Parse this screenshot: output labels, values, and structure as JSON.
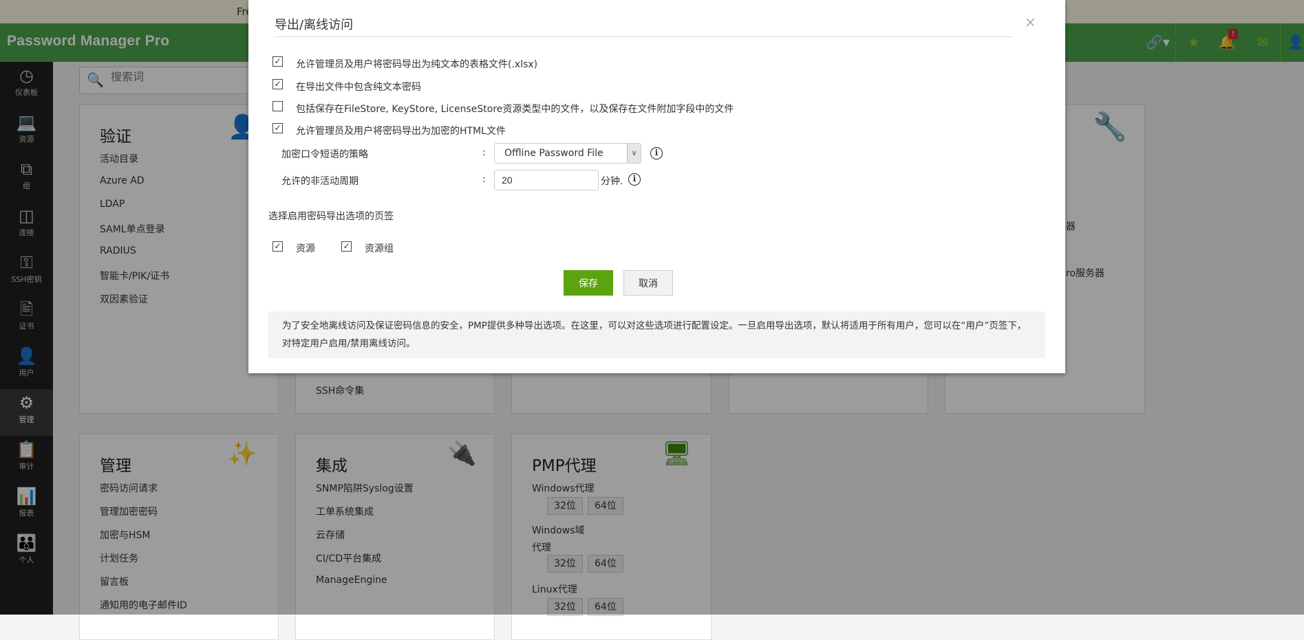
{
  "banner": {
    "text": "Fre"
  },
  "header": {
    "logo": "Password Manager Pro",
    "icons": [
      "link-icon",
      "favorite-user-icon",
      "bell-icon",
      "mail-icon",
      "user-icon"
    ]
  },
  "sidebar": {
    "items": [
      {
        "label": "仪表板",
        "icon": "dashboard-icon"
      },
      {
        "label": "资源",
        "icon": "monitor-icon"
      },
      {
        "label": "组",
        "icon": "groups-icon"
      },
      {
        "label": "连接",
        "icon": "connection-icon"
      },
      {
        "label": "SSH密钥",
        "icon": "ssh-key-icon"
      },
      {
        "label": "证书",
        "icon": "certificate-icon"
      },
      {
        "label": "用户",
        "icon": "user-icon"
      },
      {
        "label": "管理",
        "icon": "gear-icon",
        "active": true
      },
      {
        "label": "审计",
        "icon": "clipboard-icon"
      },
      {
        "label": "报表",
        "icon": "bar-chart-icon"
      },
      {
        "label": "个人",
        "icon": "personal-icon"
      }
    ]
  },
  "search": {
    "placeholder": "搜索词"
  },
  "cards": {
    "auth": {
      "title": "验证",
      "items": [
        "活动目录",
        "Azure AD",
        "LDAP",
        "SAML单点登录",
        "RADIUS",
        "智能卡/PIK/证书",
        "双因素验证"
      ]
    },
    "card2": {
      "items": [
        "SSH命令集"
      ]
    },
    "card5": {
      "items": [
        "器",
        "ro服务器"
      ]
    },
    "manage": {
      "title": "管理",
      "items": [
        "密码访问请求",
        "管理加密密码",
        "加密与HSM",
        "计划任务",
        "留言板",
        "通知用的电子邮件ID"
      ]
    },
    "integration": {
      "title": "集成",
      "items": [
        "SNMP陷阱Syslog设置",
        "工单系统集成",
        "云存储",
        "CI/CD平台集成",
        "ManageEngine"
      ]
    },
    "agent": {
      "title": "PMP代理",
      "groups": [
        {
          "label": "Windows代理",
          "b32": "32位",
          "b64": "64位"
        },
        {
          "label": "Windows域",
          "label2": "代理",
          "b32": "32位",
          "b64": "64位"
        },
        {
          "label": "Linux代理",
          "b32": "32位",
          "b64": "64位"
        }
      ]
    }
  },
  "dialog": {
    "title": "导出/离线访问",
    "close": "×",
    "options": [
      {
        "label": "允许管理员及用户将密码导出为纯文本的表格文件(.xlsx)",
        "checked": true
      },
      {
        "label": "在导出文件中包含纯文本密码",
        "checked": true
      },
      {
        "label": "包括保存在FileStore, KeyStore, LicenseStore资源类型中的文件，以及保存在文件附加字段中的文件",
        "checked": false
      },
      {
        "label": "允许管理员及用户将密码导出为加密的HTML文件",
        "checked": true
      }
    ],
    "passphrase_label": "加密口令短语的策略",
    "passphrase_value": "Offline Password File",
    "colon": ":",
    "inactive_label": "允许的非活动周期",
    "inactive_value": "20",
    "inactive_unit": "分钟.",
    "tabs_label": "选择启用密码导出选项的页签",
    "tabs": [
      {
        "label": "资源",
        "checked": true
      },
      {
        "label": "资源组",
        "checked": true
      }
    ],
    "save": "保存",
    "cancel": "取消",
    "note": "为了安全地离线访问及保证密码信息的安全，PMP提供多种导出选项。在这里，可以对这些选项进行配置设定。一旦启用导出选项，默认将适用于所有用户，您可以在“用户”页签下，对特定用户启用/禁用离线访问。"
  },
  "check_glyph": "✓",
  "colors": {
    "header": "#4ca64c",
    "accent": "#5ba30f",
    "sidebar": "#1f1f1f"
  }
}
